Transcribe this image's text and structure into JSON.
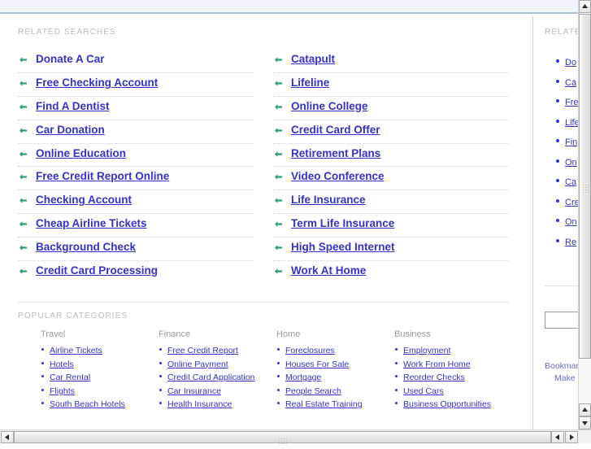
{
  "page": {
    "related_searches_label": "RELATED SEARCHES",
    "popular_categories_label": "POPULAR CATEGORIES",
    "accent_link_color": "#3333cc",
    "bullet_color": "#2e9e6b",
    "label_color": "#b9b9b9",
    "top_band_color": "#eff4fa",
    "top_rule_color": "#a8c3e0"
  },
  "related_searches": {
    "column_left": [
      {
        "label": "Donate A Car"
      },
      {
        "label": "Free Checking Account"
      },
      {
        "label": "Find A Dentist"
      },
      {
        "label": "Car Donation"
      },
      {
        "label": "Online Education"
      },
      {
        "label": "Free Credit Report Online"
      },
      {
        "label": "Checking Account"
      },
      {
        "label": "Cheap Airline Tickets"
      },
      {
        "label": "Background Check"
      },
      {
        "label": "Credit Card Processing"
      }
    ],
    "column_right": [
      {
        "label": "Catapult"
      },
      {
        "label": "Lifeline"
      },
      {
        "label": "Online College"
      },
      {
        "label": "Credit Card Offer"
      },
      {
        "label": "Retirement Plans"
      },
      {
        "label": "Video Conference"
      },
      {
        "label": "Life Insurance"
      },
      {
        "label": "Term Life Insurance"
      },
      {
        "label": "High Speed Internet"
      },
      {
        "label": "Work At Home"
      }
    ]
  },
  "popular_categories": [
    {
      "title": "Travel",
      "links": [
        "Airline Tickets",
        "Hotels",
        "Car Rental",
        "Flights",
        "South Beach Hotels"
      ]
    },
    {
      "title": "Finance",
      "links": [
        "Free Credit Report",
        "Online Payment",
        "Credit Card Application",
        "Car Insurance",
        "Health Insurance"
      ]
    },
    {
      "title": "Home",
      "links": [
        "Foreclosures",
        "Houses For Sale",
        "Mortgage",
        "People Search",
        "Real Estate Training"
      ]
    },
    {
      "title": "Business",
      "links": [
        "Employment",
        "Work From Home",
        "Reorder Checks",
        "Used Cars",
        "Business Opportunities"
      ]
    }
  ],
  "sidebar": {
    "label": "RELATED",
    "links": [
      "Do",
      "Ca",
      "Fre",
      "Life",
      "Fin",
      "On",
      "Ca",
      "Cre",
      "On",
      "Re"
    ],
    "search_value": "",
    "search_placeholder": "",
    "footer": {
      "bookmark": "Bookmark",
      "make_this": "Make this"
    }
  },
  "scrollbars": {
    "vertical": {
      "icon_up": "scroll-up-arrow",
      "icon_down": "scroll-down-arrow"
    },
    "horizontal": {
      "icon_left": "scroll-left-arrow",
      "icon_right": "scroll-right-arrow"
    }
  }
}
